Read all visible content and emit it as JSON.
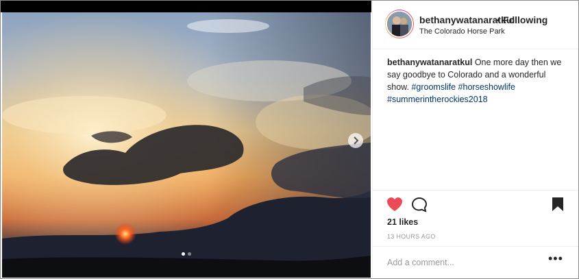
{
  "post": {
    "username": "bethanywatanaratkul",
    "separator": "•",
    "follow_label": "Following",
    "location": "The Colorado Horse Park",
    "caption": {
      "username": "bethanywatanaratkul",
      "text": " One more day then we say goodbye to Colorado and a wonderful show. ",
      "hashtags": [
        "#groomslife",
        "#horseshowlife",
        "#summerintherockies2018"
      ]
    },
    "likes": "21 likes",
    "timestamp": "13 HOURS AGO",
    "comment_placeholder": "Add a comment...",
    "more_label": "•••",
    "carousel": {
      "total": 2,
      "current": 1
    }
  },
  "icons": {
    "like": "heart-icon",
    "comment": "comment-icon",
    "save": "bookmark-icon",
    "next": "chevron-right-icon",
    "more": "more-options-icon"
  },
  "colors": {
    "liked_heart": "#ed4956",
    "hashtag": "#003569",
    "text": "#262626",
    "muted": "#999999"
  }
}
